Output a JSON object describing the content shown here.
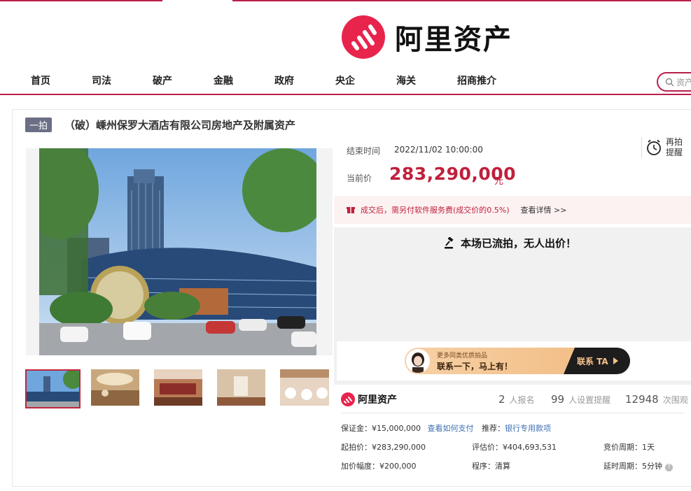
{
  "brand": {
    "name": "阿里资产",
    "accent": "#b8204a",
    "logo_red": "#e8244c"
  },
  "nav": {
    "items": [
      "首页",
      "司法",
      "破产",
      "金融",
      "政府",
      "央企",
      "海关",
      "招商推介"
    ],
    "search_placeholder": "资产"
  },
  "listing": {
    "round_badge": "一拍",
    "title": "（破）嵊州保罗大酒店有限公司房地产及附属资产",
    "end_label": "结束时间",
    "end_time": "2022/11/02 10:00:00",
    "remind_label_line1": "再拍",
    "remind_label_line2": "提醒",
    "price_label": "当前价",
    "price": "283,290,000",
    "price_unit": "元",
    "fee_notice": "成交后，需另付软件服务费(成交价的0.5%)",
    "fee_link": "查看详情 >>",
    "status": "本场已流拍，无人出价！"
  },
  "promo": {
    "small": "更多同类优质拍品",
    "big": "联系一下，马上有！",
    "button": "联系 TA"
  },
  "stats": {
    "logo_text": "阿里资产",
    "signups": "2",
    "signups_label": "人报名",
    "reminders": "99",
    "reminders_label": "人设置提醒",
    "views": "12948",
    "views_label": "次围观"
  },
  "details": {
    "deposit": "保证金：¥15,000,000",
    "deposit_link": "查看如何支付",
    "recommend_label": "推荐：",
    "recommend_link": "银行专用款项",
    "start_price": "起拍价：¥283,290,000",
    "appraisal": "评估价：¥404,693,531",
    "cycle": "竞价周期：1天",
    "increment": "加价幅度：¥200,000",
    "procedure": "程序：清算",
    "delay": "延时周期：5分钟"
  },
  "icons": {
    "search": "search-icon",
    "alarm": "alarm-clock-icon",
    "fee": "gift-icon",
    "gavel": "gavel-icon",
    "help": "question-icon"
  }
}
